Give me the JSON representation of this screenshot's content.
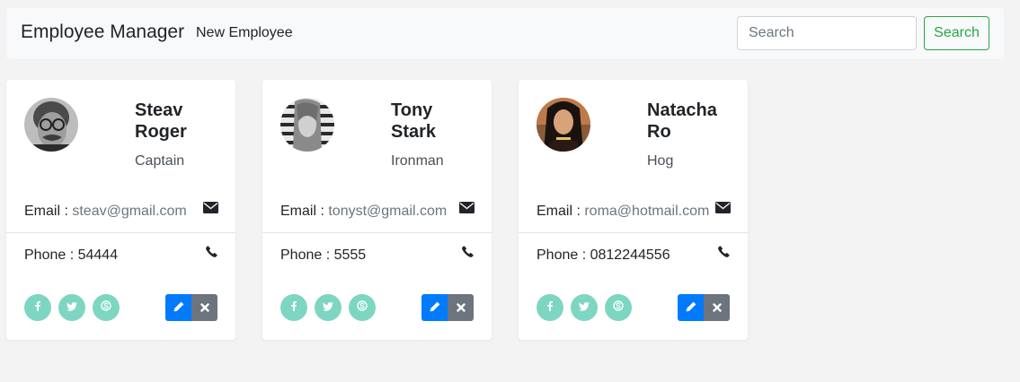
{
  "navbar": {
    "brand": "Employee Manager",
    "new_employee": "New Employee",
    "search_placeholder": "Search",
    "search_button": "Search"
  },
  "labels": {
    "email": "Email : ",
    "phone": "Phone : "
  },
  "employees": [
    {
      "name": "Steav Roger",
      "title": "Captain",
      "email": "steav@gmail.com",
      "phone": "54444"
    },
    {
      "name": "Tony Stark",
      "title": "Ironman",
      "email": "tonyst@gmail.com",
      "phone": "5555"
    },
    {
      "name": "Natacha Ro",
      "title": "Hog",
      "email": "roma@hotmail.com",
      "phone": "0812244556"
    }
  ],
  "icons": {
    "email": "envelope-icon",
    "phone": "phone-icon",
    "social": [
      "facebook-icon",
      "twitter-icon",
      "skype-icon"
    ],
    "edit": "pencil-icon",
    "delete": "times-icon"
  },
  "colors": {
    "search_accent": "#28a745",
    "social": "#7dd6c2",
    "edit": "#007bff",
    "delete": "#6c757d"
  }
}
